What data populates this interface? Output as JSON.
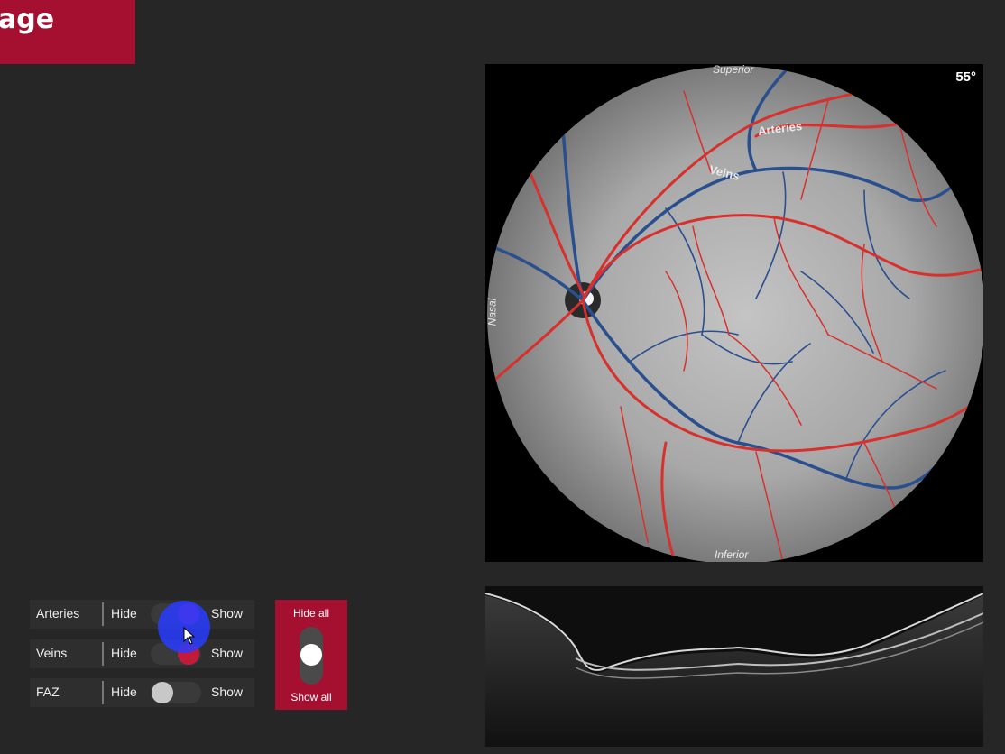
{
  "header": {
    "title_visible": "age"
  },
  "fundus": {
    "fov_label": "55°",
    "labels": {
      "superior": "Superior",
      "inferior": "Inferior",
      "nasal": "Nasal",
      "arteries": "Arteries",
      "veins": "Veins"
    },
    "colors": {
      "artery": "#d8302c",
      "vein": "#2a4f8f"
    }
  },
  "layer_toggles": {
    "hide_label": "Hide",
    "show_label": "Show",
    "items": [
      {
        "name": "Arteries",
        "state": "show",
        "knob_color": "#b51f8a"
      },
      {
        "name": "Veins",
        "state": "show",
        "knob_color": "#c31a3a"
      },
      {
        "name": "FAZ",
        "state": "hide",
        "knob_color": "#c8c8c8"
      }
    ]
  },
  "all_toggle": {
    "top_label": "Hide all",
    "bottom_label": "Show all",
    "state": "middle"
  },
  "theme": {
    "accent": "#a50f30",
    "background": "#262626"
  }
}
